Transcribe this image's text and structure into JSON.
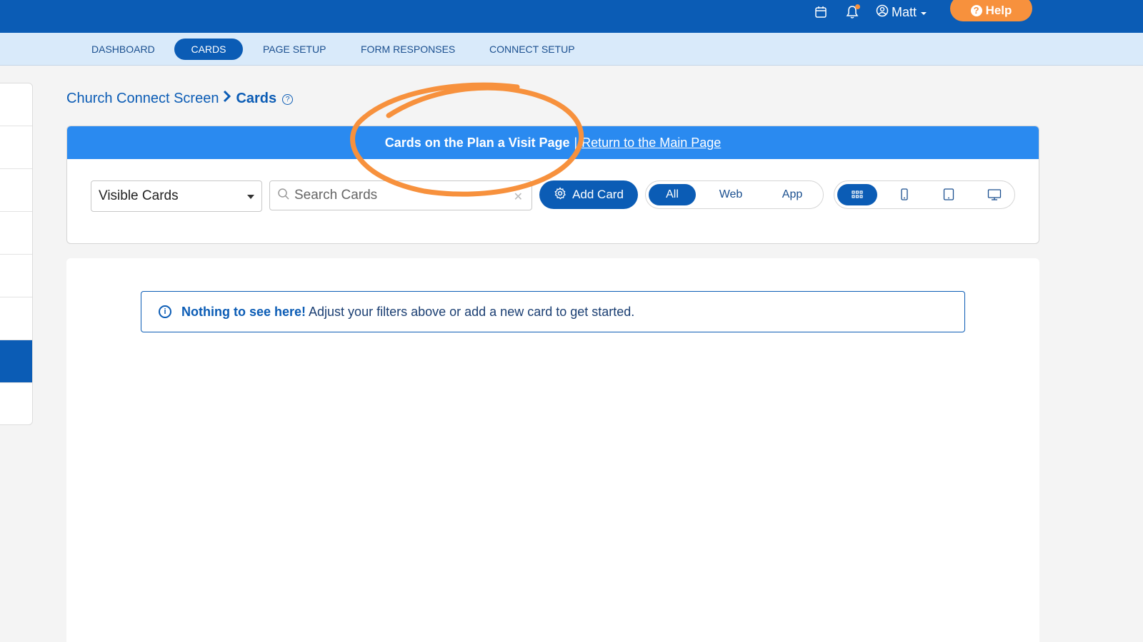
{
  "topbar": {
    "user_name": "Matt",
    "help_label": "Help",
    "icons": [
      "calendar-icon",
      "bell-icon",
      "user-circle-icon",
      "caret-down-icon",
      "question-icon"
    ]
  },
  "nav": {
    "tabs": [
      {
        "label": "DASHBOARD",
        "active": false
      },
      {
        "label": "CARDS",
        "active": true
      },
      {
        "label": "PAGE SETUP",
        "active": false
      },
      {
        "label": "FORM RESPONSES",
        "active": false
      },
      {
        "label": "CONNECT SETUP",
        "active": false
      }
    ]
  },
  "breadcrumb": {
    "parent": "Church Connect Screen",
    "current": "Cards"
  },
  "banner": {
    "title": "Cards on the Plan a Visit Page",
    "separator": "|",
    "link": "Return to the Main Page"
  },
  "filters": {
    "visibility_selected": "Visible Cards",
    "search_placeholder": "Search Cards",
    "add_card_label": "Add Card",
    "platform_options": [
      "All",
      "Web",
      "App"
    ],
    "platform_selected": "All",
    "device_options": [
      "grid-icon",
      "phone-icon",
      "tablet-icon",
      "desktop-icon"
    ],
    "device_selected": "grid-icon"
  },
  "alert": {
    "strong": "Nothing to see here!",
    "message": "Adjust your filters above or add a new card to get started."
  },
  "colors": {
    "primary": "#0b5cb5",
    "banner": "#2a8af0",
    "accent_orange": "#f7913d",
    "nav_bg": "#d9eafa"
  }
}
